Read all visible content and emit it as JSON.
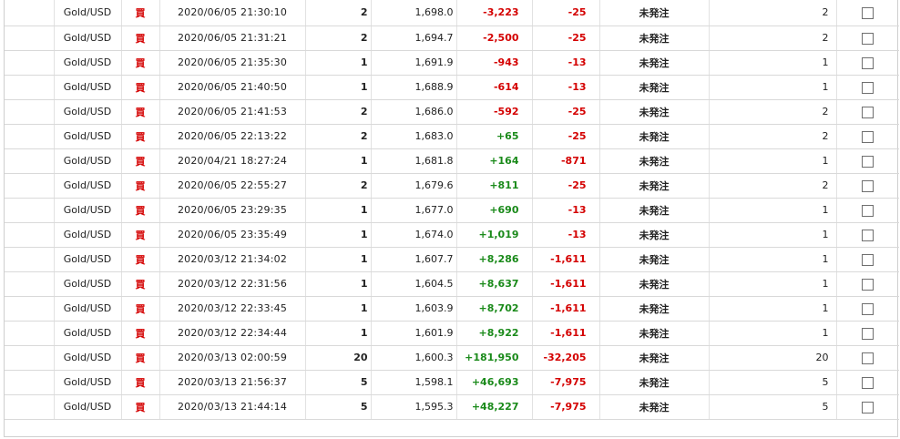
{
  "colors": {
    "negative": "#d40000",
    "positive": "#1a8a1a",
    "buy_mark": "#d40000",
    "grid_line": "#d9d9d9"
  },
  "rows": [
    {
      "symbol": "Gold/USD",
      "side": "買",
      "datetime": "2020/06/05 21:30:10",
      "qty": "2",
      "price": "1,698.0",
      "pl": "-3,223",
      "pl_sign": "neg",
      "swap": "-25",
      "status": "未発注",
      "units": "2"
    },
    {
      "symbol": "Gold/USD",
      "side": "買",
      "datetime": "2020/06/05 21:31:21",
      "qty": "2",
      "price": "1,694.7",
      "pl": "-2,500",
      "pl_sign": "neg",
      "swap": "-25",
      "status": "未発注",
      "units": "2"
    },
    {
      "symbol": "Gold/USD",
      "side": "買",
      "datetime": "2020/06/05 21:35:30",
      "qty": "1",
      "price": "1,691.9",
      "pl": "-943",
      "pl_sign": "neg",
      "swap": "-13",
      "status": "未発注",
      "units": "1"
    },
    {
      "symbol": "Gold/USD",
      "side": "買",
      "datetime": "2020/06/05 21:40:50",
      "qty": "1",
      "price": "1,688.9",
      "pl": "-614",
      "pl_sign": "neg",
      "swap": "-13",
      "status": "未発注",
      "units": "1"
    },
    {
      "symbol": "Gold/USD",
      "side": "買",
      "datetime": "2020/06/05 21:41:53",
      "qty": "2",
      "price": "1,686.0",
      "pl": "-592",
      "pl_sign": "neg",
      "swap": "-25",
      "status": "未発注",
      "units": "2"
    },
    {
      "symbol": "Gold/USD",
      "side": "買",
      "datetime": "2020/06/05 22:13:22",
      "qty": "2",
      "price": "1,683.0",
      "pl": "+65",
      "pl_sign": "pos",
      "swap": "-25",
      "status": "未発注",
      "units": "2"
    },
    {
      "symbol": "Gold/USD",
      "side": "買",
      "datetime": "2020/04/21 18:27:24",
      "qty": "1",
      "price": "1,681.8",
      "pl": "+164",
      "pl_sign": "pos",
      "swap": "-871",
      "status": "未発注",
      "units": "1"
    },
    {
      "symbol": "Gold/USD",
      "side": "買",
      "datetime": "2020/06/05 22:55:27",
      "qty": "2",
      "price": "1,679.6",
      "pl": "+811",
      "pl_sign": "pos",
      "swap": "-25",
      "status": "未発注",
      "units": "2"
    },
    {
      "symbol": "Gold/USD",
      "side": "買",
      "datetime": "2020/06/05 23:29:35",
      "qty": "1",
      "price": "1,677.0",
      "pl": "+690",
      "pl_sign": "pos",
      "swap": "-13",
      "status": "未発注",
      "units": "1"
    },
    {
      "symbol": "Gold/USD",
      "side": "買",
      "datetime": "2020/06/05 23:35:49",
      "qty": "1",
      "price": "1,674.0",
      "pl": "+1,019",
      "pl_sign": "pos",
      "swap": "-13",
      "status": "未発注",
      "units": "1"
    },
    {
      "symbol": "Gold/USD",
      "side": "買",
      "datetime": "2020/03/12 21:34:02",
      "qty": "1",
      "price": "1,607.7",
      "pl": "+8,286",
      "pl_sign": "pos",
      "swap": "-1,611",
      "status": "未発注",
      "units": "1"
    },
    {
      "symbol": "Gold/USD",
      "side": "買",
      "datetime": "2020/03/12 22:31:56",
      "qty": "1",
      "price": "1,604.5",
      "pl": "+8,637",
      "pl_sign": "pos",
      "swap": "-1,611",
      "status": "未発注",
      "units": "1"
    },
    {
      "symbol": "Gold/USD",
      "side": "買",
      "datetime": "2020/03/12 22:33:45",
      "qty": "1",
      "price": "1,603.9",
      "pl": "+8,702",
      "pl_sign": "pos",
      "swap": "-1,611",
      "status": "未発注",
      "units": "1"
    },
    {
      "symbol": "Gold/USD",
      "side": "買",
      "datetime": "2020/03/12 22:34:44",
      "qty": "1",
      "price": "1,601.9",
      "pl": "+8,922",
      "pl_sign": "pos",
      "swap": "-1,611",
      "status": "未発注",
      "units": "1"
    },
    {
      "symbol": "Gold/USD",
      "side": "買",
      "datetime": "2020/03/13 02:00:59",
      "qty": "20",
      "price": "1,600.3",
      "pl": "+181,950",
      "pl_sign": "pos",
      "swap": "-32,205",
      "status": "未発注",
      "units": "20"
    },
    {
      "symbol": "Gold/USD",
      "side": "買",
      "datetime": "2020/03/13 21:56:37",
      "qty": "5",
      "price": "1,598.1",
      "pl": "+46,693",
      "pl_sign": "pos",
      "swap": "-7,975",
      "status": "未発注",
      "units": "5"
    },
    {
      "symbol": "Gold/USD",
      "side": "買",
      "datetime": "2020/03/13 21:44:14",
      "qty": "5",
      "price": "1,595.3",
      "pl": "+48,227",
      "pl_sign": "pos",
      "swap": "-7,975",
      "status": "未発注",
      "units": "5"
    }
  ]
}
